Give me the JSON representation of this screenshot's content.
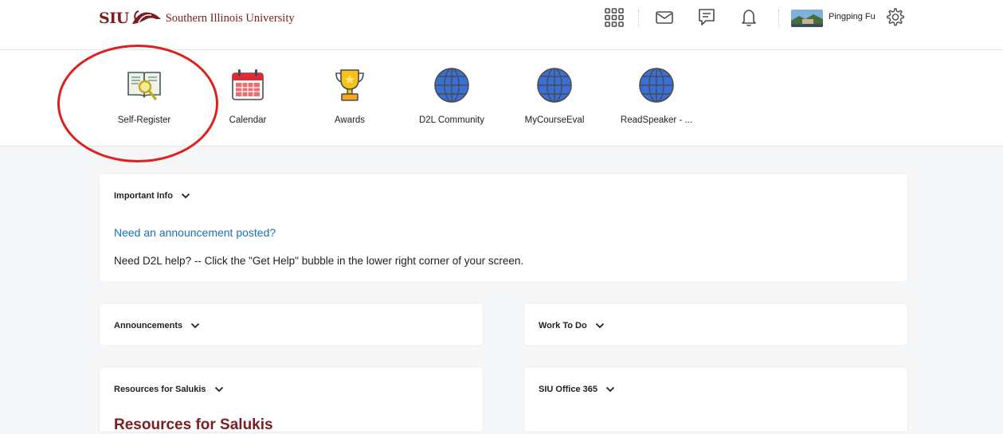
{
  "header": {
    "logo_abbr": "SIU",
    "university_name": "Southern Illinois University",
    "icons": [
      "waffle-grid-icon",
      "mail-icon",
      "chat-icon",
      "bell-icon",
      "settings-gear-icon"
    ],
    "user_name": "Pingping Fu"
  },
  "nav_tiles": [
    {
      "label": "Self-Register",
      "icon": "book-search-icon"
    },
    {
      "label": "Calendar",
      "icon": "calendar-icon"
    },
    {
      "label": "Awards",
      "icon": "trophy-icon"
    },
    {
      "label": "D2L Community",
      "icon": "globe-icon"
    },
    {
      "label": "MyCourseEval",
      "icon": "globe-icon"
    },
    {
      "label": "ReadSpeaker - ...",
      "icon": "globe-icon"
    }
  ],
  "widgets": {
    "important_info": {
      "title": "Important Info",
      "link": "Need an announcement posted?",
      "help": "Need D2L help? -- Click the \"Get Help\" bubble in the lower right corner of your screen."
    },
    "announcements": {
      "title": "Announcements"
    },
    "work_to_do": {
      "title": "Work To Do"
    },
    "resources": {
      "title": "Resources for Salukis",
      "heading": "Resources for Salukis"
    },
    "office365": {
      "title": "SIU Office 365"
    }
  },
  "colors": {
    "brand_maroon": "#7a1e22",
    "link_blue": "#1a6fb5",
    "highlight_red": "#e0201c",
    "globe_blue": "#3a6fd8"
  }
}
